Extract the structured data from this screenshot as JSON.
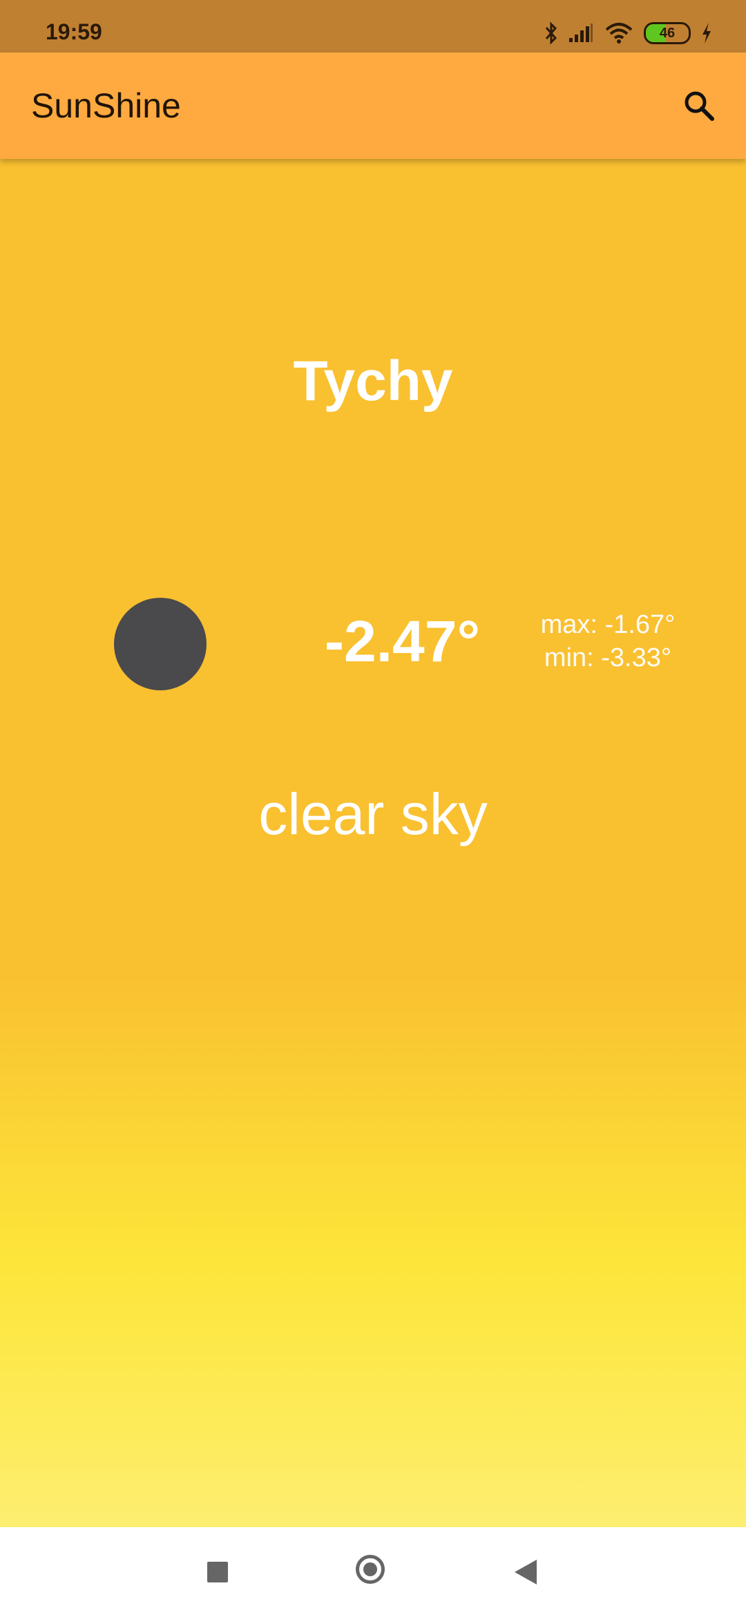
{
  "status_bar": {
    "time": "19:59",
    "battery": "46",
    "battery_level": 0.46,
    "icons": [
      "bluetooth-icon",
      "signal-icon",
      "wifi-icon",
      "battery-icon",
      "charging-icon"
    ]
  },
  "app_bar": {
    "title": "SunShine",
    "action_icon": "search-icon"
  },
  "weather": {
    "city": "Tychy",
    "temperature": "-2.47°",
    "max": "max: -1.67°",
    "min": "min: -3.33°",
    "description": "clear sky",
    "icon_color": "#4a4a4c"
  },
  "colors": {
    "status_bar": "#c08032",
    "app_bar": "#ffaa40",
    "background_top": "#f9c030",
    "background_bottom": "#fdf088"
  },
  "nav_bar": {
    "buttons": [
      "recents",
      "home",
      "back"
    ]
  }
}
